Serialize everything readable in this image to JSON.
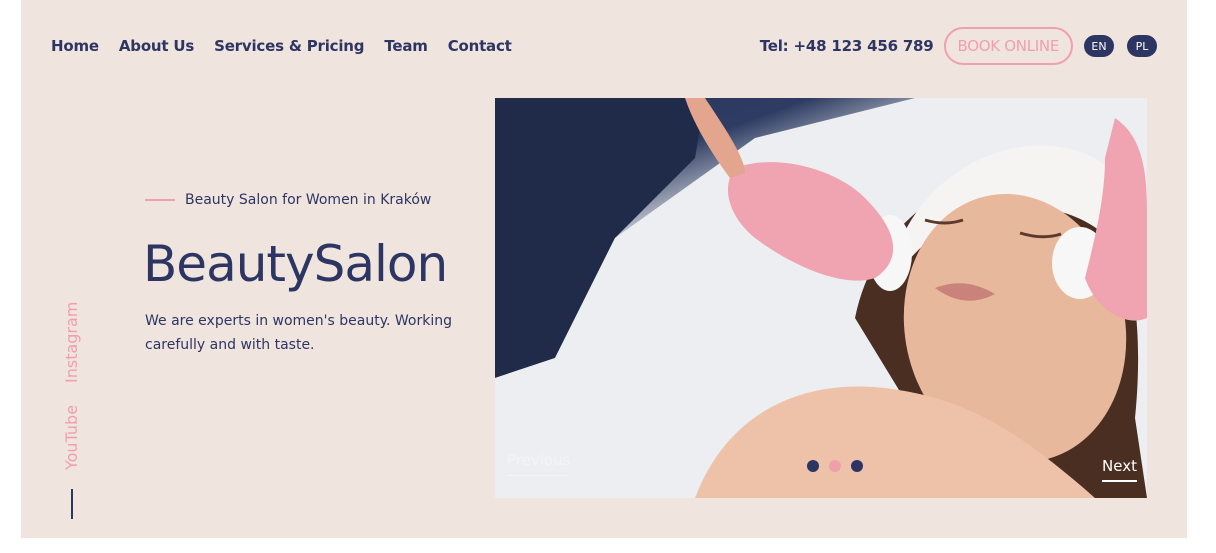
{
  "nav": {
    "items": [
      {
        "label": "Home"
      },
      {
        "label": "About Us"
      },
      {
        "label": "Services & Pricing"
      },
      {
        "label": "Team"
      },
      {
        "label": "Contact"
      }
    ]
  },
  "header": {
    "tel": "Tel: +48 123 456 789",
    "book_label": "BOOK ONLINE",
    "languages": [
      "EN",
      "PL"
    ]
  },
  "social": {
    "youtube": "YouTube",
    "instagram": "Instagram"
  },
  "hero": {
    "eyebrow": "Beauty Salon for Women in Kraków",
    "title": "BeautySalon",
    "description": "We are experts in women's beauty. Working carefully and with taste."
  },
  "slider": {
    "prev_label": "Previous",
    "next_label": "Next",
    "image_icon": "salon-photo-icon",
    "dots": [
      {
        "active": false
      },
      {
        "active": true
      },
      {
        "active": false
      }
    ]
  },
  "colors": {
    "background": "#f0e4de",
    "navy": "#2d3563",
    "pink": "#efa0ac"
  }
}
